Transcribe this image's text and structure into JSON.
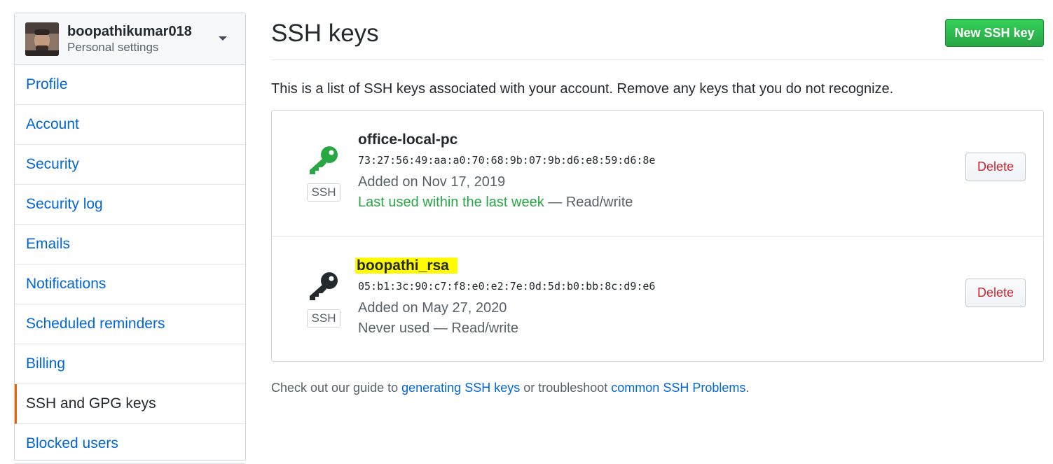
{
  "account": {
    "username": "boopathikumar018",
    "subtitle": "Personal settings"
  },
  "sidebar": {
    "items": [
      {
        "label": "Profile"
      },
      {
        "label": "Account"
      },
      {
        "label": "Security"
      },
      {
        "label": "Security log"
      },
      {
        "label": "Emails"
      },
      {
        "label": "Notifications"
      },
      {
        "label": "Scheduled reminders"
      },
      {
        "label": "Billing"
      },
      {
        "label": "SSH and GPG keys",
        "active": true
      },
      {
        "label": "Blocked users"
      }
    ]
  },
  "header": {
    "title": "SSH keys",
    "new_key_button": "New SSH key"
  },
  "intro_text": "This is a list of SSH keys associated with your account. Remove any keys that you do not recognize.",
  "keys": [
    {
      "name": "office-local-pc",
      "fingerprint": "73:27:56:49:aa:a0:70:68:9b:07:9b:d6:e8:59:d6:8e",
      "added": "Added on Nov 17, 2019",
      "usage_recent": "Last used within the last week",
      "usage_suffix": " — Read/write",
      "type_label": "SSH",
      "delete_label": "Delete",
      "icon_color": "#28a745"
    },
    {
      "name": "boopathi_rsa",
      "fingerprint": "05:b1:3c:90:c7:f8:e0:e2:7e:0d:5d:b0:bb:8c:d9:e6",
      "added": "Added on May 27, 2020",
      "usage_recent": "",
      "usage_suffix": "Never used — Read/write",
      "type_label": "SSH",
      "delete_label": "Delete",
      "icon_color": "#24292e",
      "highlighted": true
    }
  ],
  "footer": {
    "prefix": "Check out our guide to ",
    "link1": "generating SSH keys",
    "middle": " or troubleshoot ",
    "link2": "common SSH Problems",
    "suffix": "."
  }
}
